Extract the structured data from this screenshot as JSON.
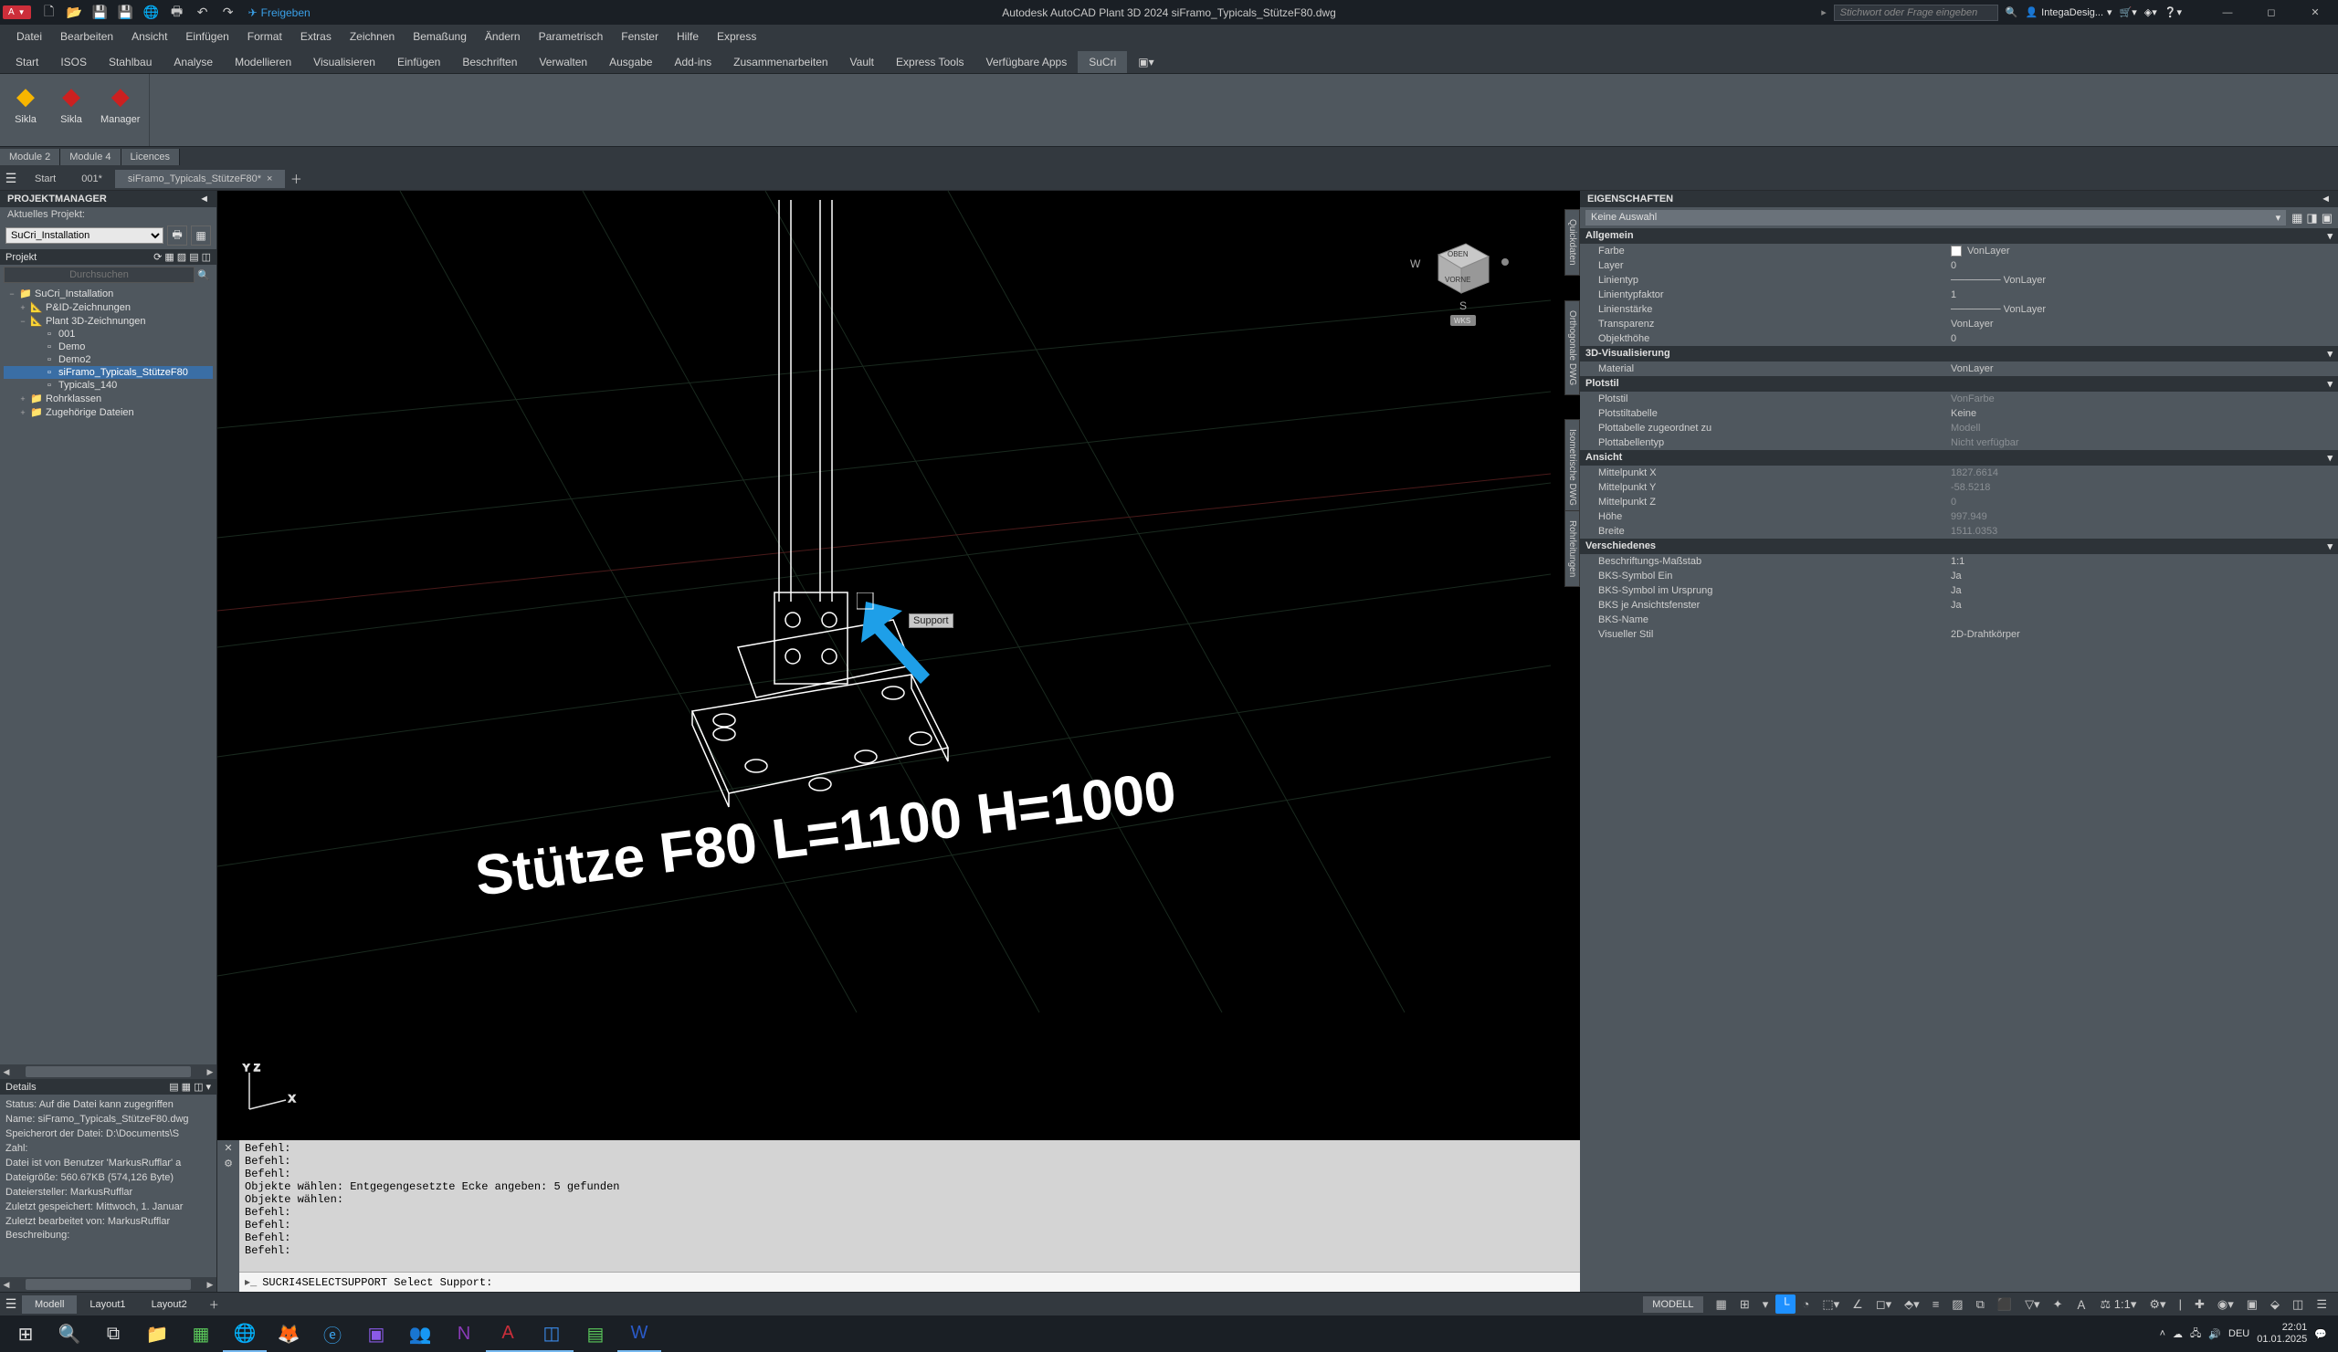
{
  "titlebar": {
    "app": "A",
    "share": "Freigeben",
    "title": "Autodesk AutoCAD Plant 3D 2024   siFramo_Typicals_StützeF80.dwg",
    "search_placeholder": "Stichwort oder Frage eingeben",
    "user": "IntegaDesig..."
  },
  "menus": [
    "Datei",
    "Bearbeiten",
    "Ansicht",
    "Einfügen",
    "Format",
    "Extras",
    "Zeichnen",
    "Bemaßung",
    "Ändern",
    "Parametrisch",
    "Fenster",
    "Hilfe",
    "Express"
  ],
  "tabs": [
    "Start",
    "ISOS",
    "Stahlbau",
    "Analyse",
    "Modellieren",
    "Visualisieren",
    "Einfügen",
    "Beschriften",
    "Verwalten",
    "Ausgabe",
    "Add-ins",
    "Zusammenarbeiten",
    "Vault",
    "Express Tools",
    "Verfügbare Apps",
    "SuCri",
    "▣▾"
  ],
  "active_tab": "SuCri",
  "ribbon": {
    "btns": [
      {
        "label": "Sikla",
        "color": "#f7b500"
      },
      {
        "label": "Sikla",
        "color": "#cc2020"
      },
      {
        "label": "Manager",
        "color": "#cc2020"
      }
    ],
    "groups": [
      "Module 2",
      "Module 4",
      "Licences"
    ]
  },
  "doc_tabs": [
    "Start",
    "001*",
    "siFramo_Typicals_StützeF80*"
  ],
  "doc_active": 2,
  "projectmanager": {
    "title": "PROJEKTMANAGER",
    "subtitle": "Aktuelles Projekt:",
    "project_select": "SuCri_Installation",
    "section": "Projekt",
    "search_placeholder": "Durchsuchen",
    "tree": [
      {
        "lvl": 0,
        "exp": "−",
        "icon": "📁",
        "label": "SuCri_Installation"
      },
      {
        "lvl": 1,
        "exp": "+",
        "icon": "📐",
        "label": "P&ID-Zeichnungen"
      },
      {
        "lvl": 1,
        "exp": "−",
        "icon": "📐",
        "label": "Plant 3D-Zeichnungen"
      },
      {
        "lvl": 2,
        "exp": "",
        "icon": "▫",
        "label": "001"
      },
      {
        "lvl": 2,
        "exp": "",
        "icon": "▫",
        "label": "Demo"
      },
      {
        "lvl": 2,
        "exp": "",
        "icon": "▫",
        "label": "Demo2"
      },
      {
        "lvl": 2,
        "exp": "",
        "icon": "▫",
        "label": "siFramo_Typicals_StützeF80",
        "sel": true
      },
      {
        "lvl": 2,
        "exp": "",
        "icon": "▫",
        "label": "Typicals_140"
      },
      {
        "lvl": 1,
        "exp": "+",
        "icon": "📁",
        "label": "Rohrklassen"
      },
      {
        "lvl": 1,
        "exp": "+",
        "icon": "📁",
        "label": "Zugehörige Dateien"
      }
    ],
    "details_title": "Details",
    "details": "Status: Auf die Datei kann zugegriffen \nName: siFramo_Typicals_StützeF80.dwg\nSpeicherort der Datei: D:\\Documents\\S\nZahl:\nDatei ist von Benutzer 'MarkusRufflar' a\nDateigröße: 560.67KB (574,126 Byte)\nDateiersteller: MarkusRufflar\nZuletzt gespeichert: Mittwoch, 1. Januar\nZuletzt bearbeitet von: MarkusRufflar\nBeschreibung:"
  },
  "viewport": {
    "side_tabs": [
      "Quickdaten",
      "Orthogonale DWG",
      "Isometrische DWG",
      "Rohrleitungen"
    ],
    "model_text": "Stütze F80 L=1100 H=1000",
    "tooltip": "Support",
    "viewcube": {
      "top": "OBEN",
      "front": "VORNE",
      "w": "W",
      "s": "S",
      "wcs": "WKS"
    }
  },
  "command": {
    "history": "Befehl:\nBefehl:\nBefehl:\nObjekte wählen: Entgegengesetzte Ecke angeben: 5 gefunden\nObjekte wählen:\nBefehl:\nBefehl:\nBefehl:\nBefehl:",
    "prompt": "SUCRI4SELECTSUPPORT Select Support:"
  },
  "properties": {
    "title": "EIGENSCHAFTEN",
    "selection": "Keine Auswahl",
    "groups": [
      {
        "name": "Allgemein",
        "rows": [
          {
            "n": "Farbe",
            "v": "VonLayer",
            "sw": true
          },
          {
            "n": "Layer",
            "v": "0"
          },
          {
            "n": "Linientyp",
            "v": "─────── VonLayer"
          },
          {
            "n": "Linientypfaktor",
            "v": "1"
          },
          {
            "n": "Linienstärke",
            "v": "─────── VonLayer"
          },
          {
            "n": "Transparenz",
            "v": "VonLayer"
          },
          {
            "n": "Objekthöhe",
            "v": "0"
          }
        ]
      },
      {
        "name": "3D-Visualisierung",
        "rows": [
          {
            "n": "Material",
            "v": "VonLayer"
          }
        ]
      },
      {
        "name": "Plotstil",
        "rows": [
          {
            "n": "Plotstil",
            "v": "VonFarbe",
            "dim": true
          },
          {
            "n": "Plotstiltabelle",
            "v": "Keine"
          },
          {
            "n": "Plottabelle zugeordnet zu",
            "v": "Modell",
            "dim": true
          },
          {
            "n": "Plottabellentyp",
            "v": "Nicht verfügbar",
            "dim": true
          }
        ]
      },
      {
        "name": "Ansicht",
        "rows": [
          {
            "n": "Mittelpunkt X",
            "v": "1827.6614",
            "dim": true
          },
          {
            "n": "Mittelpunkt Y",
            "v": "-58.5218",
            "dim": true
          },
          {
            "n": "Mittelpunkt Z",
            "v": "0",
            "dim": true
          },
          {
            "n": "Höhe",
            "v": "997.949",
            "dim": true
          },
          {
            "n": "Breite",
            "v": "1511.0353",
            "dim": true
          }
        ]
      },
      {
        "name": "Verschiedenes",
        "rows": [
          {
            "n": "Beschriftungs-Maßstab",
            "v": "1:1"
          },
          {
            "n": "BKS-Symbol Ein",
            "v": "Ja"
          },
          {
            "n": "BKS-Symbol im Ursprung",
            "v": "Ja"
          },
          {
            "n": "BKS je Ansichtsfenster",
            "v": "Ja"
          },
          {
            "n": "BKS-Name",
            "v": ""
          },
          {
            "n": "Visueller Stil",
            "v": "2D-Drahtkörper"
          }
        ]
      }
    ]
  },
  "layout_tabs": [
    "Modell",
    "Layout1",
    "Layout2"
  ],
  "layout_active": 0,
  "statusbar": {
    "model": "MODELL"
  },
  "taskbar": {
    "time": "22:01",
    "date": "01.01.2025"
  }
}
